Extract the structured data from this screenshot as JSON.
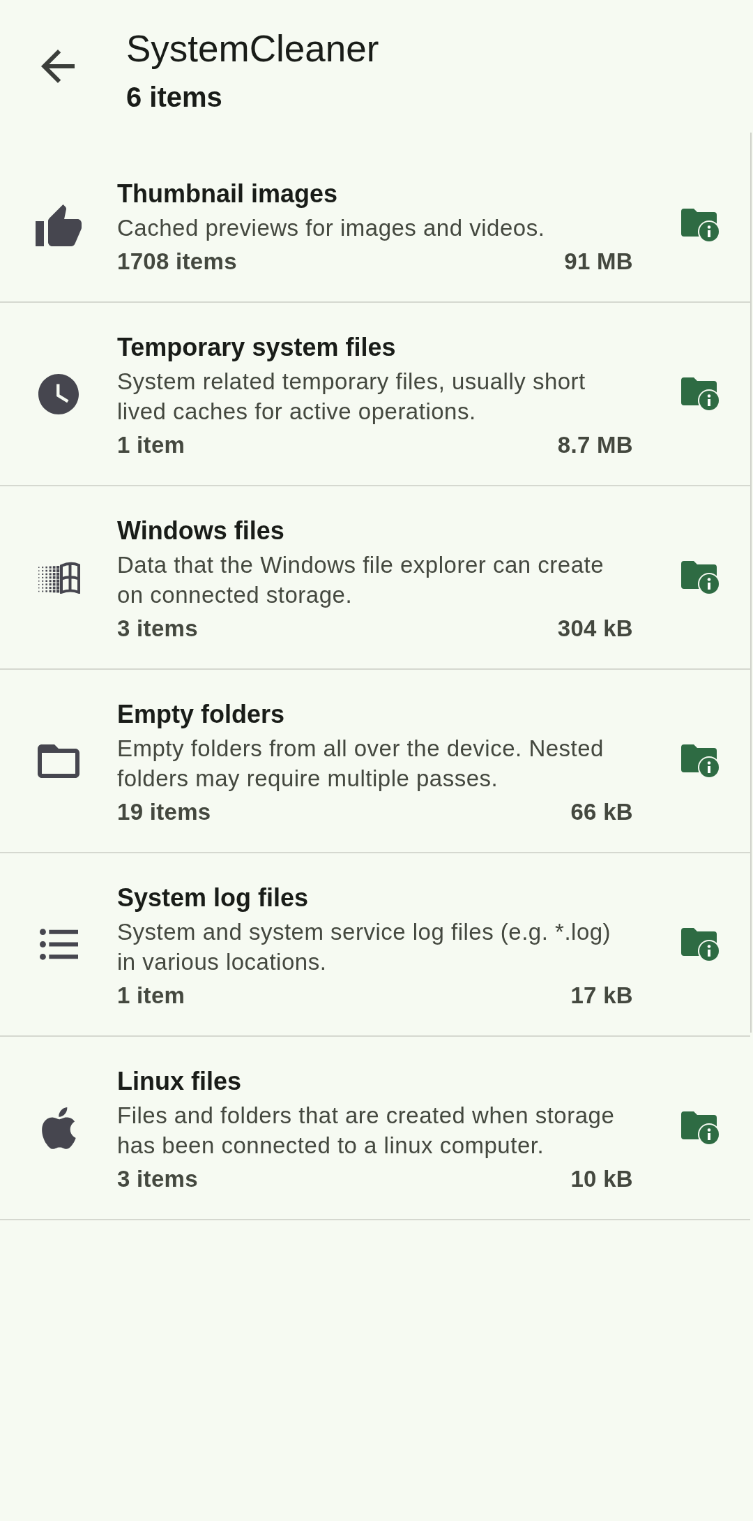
{
  "app_bar": {
    "title": "SystemCleaner",
    "subtitle": "6 items"
  },
  "items": [
    {
      "kind": "thumbnails",
      "title": "Thumbnail images",
      "description": "Cached previews for images and videos.",
      "count": "1708 items",
      "size": "91 MB"
    },
    {
      "kind": "temporary",
      "title": "Temporary system files",
      "description": "System related temporary files, usually short lived caches for active operations.",
      "count": "1 item",
      "size": "8.7 MB"
    },
    {
      "kind": "windows",
      "title": "Windows files",
      "description": "Data that the Windows file explorer can create on connected storage.",
      "count": "3 items",
      "size": "304 kB"
    },
    {
      "kind": "folders",
      "title": "Empty folders",
      "description": "Empty folders from all over the device. Nested folders may require multiple passes.",
      "count": "19 items",
      "size": "66 kB"
    },
    {
      "kind": "logs",
      "title": "System log files",
      "description": "System and system service log files (e.g. *.log) in various locations.",
      "count": "1 item",
      "size": "17 kB"
    },
    {
      "kind": "linux",
      "title": "Linux files",
      "description": "Files and folders that are created when storage has been connected to a linux computer.",
      "count": "3 items",
      "size": "10 kB"
    }
  ]
}
